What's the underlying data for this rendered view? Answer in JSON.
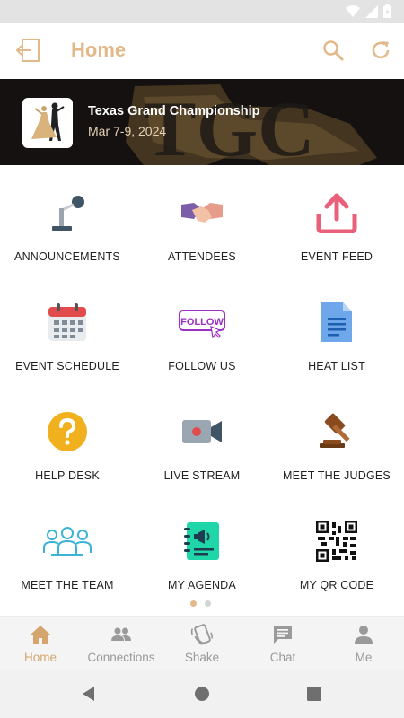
{
  "app_bar": {
    "title": "Home"
  },
  "event": {
    "name": "Texas Grand Championship",
    "dates": "Mar 7-9, 2024",
    "banner_text": "TGC"
  },
  "tiles": [
    {
      "label": "ANNOUNCEMENTS",
      "icon": "microphone-icon"
    },
    {
      "label": "ATTENDEES",
      "icon": "handshake-icon"
    },
    {
      "label": "EVENT FEED",
      "icon": "upload-icon"
    },
    {
      "label": "EVENT SCHEDULE",
      "icon": "calendar-icon"
    },
    {
      "label": "FOLLOW US",
      "icon": "follow-icon"
    },
    {
      "label": "HEAT LIST",
      "icon": "document-icon"
    },
    {
      "label": "HELP DESK",
      "icon": "question-icon"
    },
    {
      "label": "LIVE STREAM",
      "icon": "video-camera-icon"
    },
    {
      "label": "MEET THE JUDGES",
      "icon": "gavel-icon"
    },
    {
      "label": "MEET THE TEAM",
      "icon": "team-icon"
    },
    {
      "label": "MY AGENDA",
      "icon": "agenda-icon"
    },
    {
      "label": "MY QR CODE",
      "icon": "qr-code-icon"
    }
  ],
  "follow_text": "FOLLOW",
  "pager": {
    "pages": 2,
    "current": 1
  },
  "bottom_nav": [
    {
      "label": "Home",
      "icon": "home-icon",
      "active": true
    },
    {
      "label": "Connections",
      "icon": "people-icon",
      "active": false
    },
    {
      "label": "Shake",
      "icon": "shake-icon",
      "active": false
    },
    {
      "label": "Chat",
      "icon": "chat-icon",
      "active": false
    },
    {
      "label": "Me",
      "icon": "person-icon",
      "active": false
    }
  ],
  "colors": {
    "accent": "#e2b98a",
    "nav_active": "#d4a66e",
    "nav_inactive": "#9a9a9a"
  }
}
